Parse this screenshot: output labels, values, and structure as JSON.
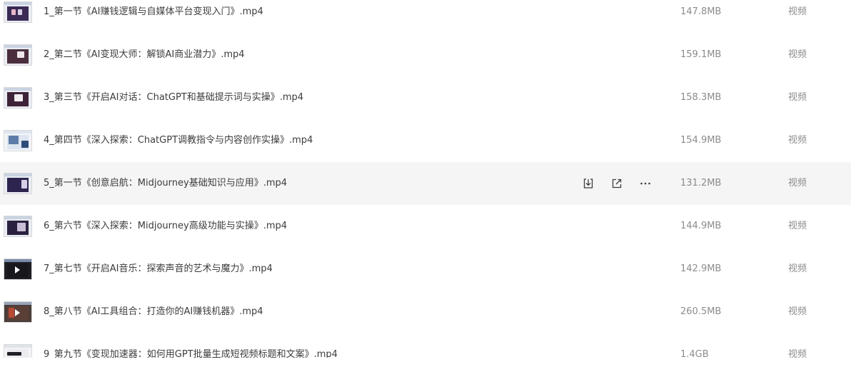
{
  "files": [
    {
      "name": "1_第一节《AI赚钱逻辑与自媒体平台变现入门》.mp4",
      "size": "147.8MB",
      "type": "视频"
    },
    {
      "name": "2_第二节《AI变现大师：解锁AI商业潜力》.mp4",
      "size": "159.1MB",
      "type": "视频"
    },
    {
      "name": "3_第三节《开启AI对话：ChatGPT和基础提示词与实操》.mp4",
      "size": "158.3MB",
      "type": "视频"
    },
    {
      "name": "4_第四节《深入探索：ChatGPT调教指令与内容创作实操》.mp4",
      "size": "154.9MB",
      "type": "视频"
    },
    {
      "name": "5_第一节《创意启航：Midjourney基础知识与应用》.mp4",
      "size": "131.2MB",
      "type": "视频"
    },
    {
      "name": "6_第六节《深入探索：Midjourney高级功能与实操》.mp4",
      "size": "144.9MB",
      "type": "视频"
    },
    {
      "name": "7_第七节《开启AI音乐：探索声音的艺术与魔力》.mp4",
      "size": "142.9MB",
      "type": "视频"
    },
    {
      "name": "8_第八节《AI工具组合：打造你的AI赚钱机器》.mp4",
      "size": "260.5MB",
      "type": "视频"
    },
    {
      "name": "9_第九节《变现加速器：如何用GPT批量生成短视频标题和文案》.mp4",
      "size": "1.4GB",
      "type": "视频"
    }
  ],
  "hover_actions": {
    "download_icon": "download-icon",
    "share_icon": "share-icon",
    "more_icon": "more-icon"
  },
  "colors": {
    "hover_row": "#f5f5f6",
    "name_text": "#3c3c3c",
    "meta_text": "#8c8c8c",
    "icon": "#3c3c3c"
  }
}
